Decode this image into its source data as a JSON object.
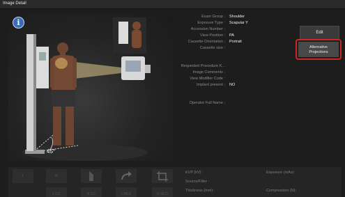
{
  "window": {
    "title": "Image Detail"
  },
  "scene": {
    "angle": "45°"
  },
  "fields": [
    {
      "label": "Exam Group :",
      "value": "Shoulder"
    },
    {
      "label": "Exposure Type :",
      "value": "Scapular Y"
    },
    {
      "label": "Accession Number :",
      "value": ""
    },
    {
      "label": "View Position :",
      "value": "PA"
    },
    {
      "label": "Cassette Orientation :",
      "value": "Portrait"
    },
    {
      "label": "Cassette size :",
      "value": ""
    },
    {
      "label": "Requested Procedure K...",
      "value": ""
    },
    {
      "label": "Image Comments :",
      "value": ""
    },
    {
      "label": "View Modifier Code :",
      "value": ""
    },
    {
      "label": "Implant present :",
      "value": "NO"
    },
    {
      "label": "Operator Full Name :",
      "value": ""
    }
  ],
  "buttons": {
    "edit": "Edit",
    "alternative_line1": "Alternative",
    "alternative_line2": "Projections"
  },
  "projection_buttons": [
    "L",
    "R",
    "",
    "",
    "",
    "L CC",
    "R CC",
    "L MLO",
    "R MLO"
  ],
  "technique": {
    "kvp": "KVP (kV):",
    "source_filter": "Source/Filter :",
    "thickness": "Thickness (mm):",
    "exposure": "Exposure (mAs):",
    "compression": "Compression (N):"
  },
  "colors": {
    "highlight": "#d0261e",
    "info": "#3a6bb8"
  }
}
